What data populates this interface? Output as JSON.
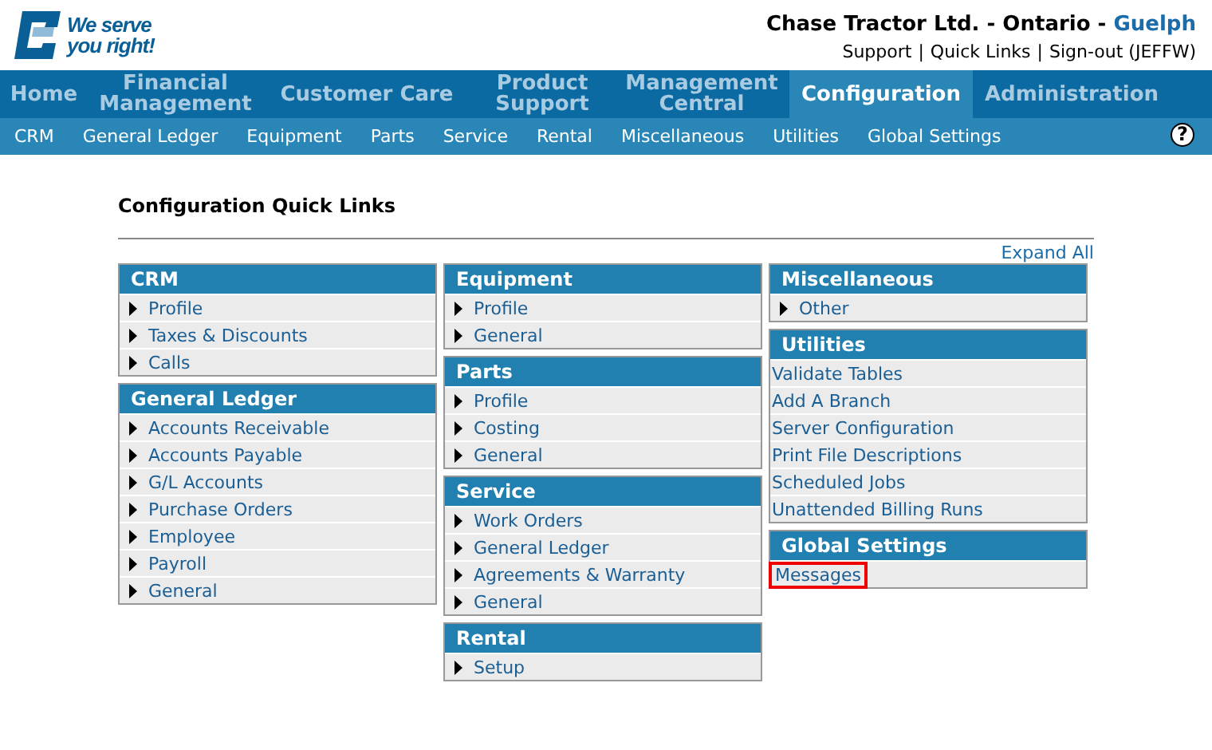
{
  "logo": {
    "slogan_lines": [
      "We serve",
      "you right!"
    ]
  },
  "header": {
    "company": "Chase Tractor Ltd. - Ontario -",
    "branch": "Guelph",
    "links": [
      "Support",
      "Quick Links",
      "Sign-out (JEFFW)"
    ],
    "separator": "|"
  },
  "main_nav": [
    {
      "label": "Home",
      "selected": false
    },
    {
      "label": "Financial Management",
      "selected": false
    },
    {
      "label": "Customer Care",
      "selected": false
    },
    {
      "label": "Product Support",
      "selected": false
    },
    {
      "label": "Management Central",
      "selected": false
    },
    {
      "label": "Configuration",
      "selected": true
    },
    {
      "label": "Administration",
      "selected": false
    }
  ],
  "sub_nav": [
    "CRM",
    "General Ledger",
    "Equipment",
    "Parts",
    "Service",
    "Rental",
    "Miscellaneous",
    "Utilities",
    "Global Settings"
  ],
  "help": {
    "label": "?"
  },
  "page_title": "Configuration Quick Links",
  "expand_all": "Expand All",
  "columns": [
    [
      {
        "title": "CRM",
        "items": [
          {
            "label": "Profile",
            "kind": "arrow",
            "highlighted": false
          },
          {
            "label": "Taxes & Discounts",
            "kind": "arrow",
            "highlighted": false
          },
          {
            "label": "Calls",
            "kind": "arrow",
            "highlighted": false
          }
        ]
      },
      {
        "title": "General Ledger",
        "items": [
          {
            "label": "Accounts Receivable",
            "kind": "arrow",
            "highlighted": false
          },
          {
            "label": "Accounts Payable",
            "kind": "arrow",
            "highlighted": false
          },
          {
            "label": "G/L Accounts",
            "kind": "arrow",
            "highlighted": false
          },
          {
            "label": "Purchase Orders",
            "kind": "arrow",
            "highlighted": false
          },
          {
            "label": "Employee",
            "kind": "arrow",
            "highlighted": false
          },
          {
            "label": "Payroll",
            "kind": "arrow",
            "highlighted": false
          },
          {
            "label": "General",
            "kind": "arrow",
            "highlighted": false
          }
        ]
      }
    ],
    [
      {
        "title": "Equipment",
        "items": [
          {
            "label": "Profile",
            "kind": "arrow",
            "highlighted": false
          },
          {
            "label": "General",
            "kind": "arrow",
            "highlighted": false
          }
        ]
      },
      {
        "title": "Parts",
        "items": [
          {
            "label": "Profile",
            "kind": "arrow",
            "highlighted": false
          },
          {
            "label": "Costing",
            "kind": "arrow",
            "highlighted": false
          },
          {
            "label": "General",
            "kind": "arrow",
            "highlighted": false
          }
        ]
      },
      {
        "title": "Service",
        "items": [
          {
            "label": "Work Orders",
            "kind": "arrow",
            "highlighted": false
          },
          {
            "label": "General Ledger",
            "kind": "arrow",
            "highlighted": false
          },
          {
            "label": "Agreements & Warranty",
            "kind": "arrow",
            "highlighted": false
          },
          {
            "label": "General",
            "kind": "arrow",
            "highlighted": false
          }
        ]
      },
      {
        "title": "Rental",
        "items": [
          {
            "label": "Setup",
            "kind": "arrow",
            "highlighted": false
          }
        ]
      }
    ],
    [
      {
        "title": "Miscellaneous",
        "items": [
          {
            "label": "Other",
            "kind": "arrow",
            "highlighted": false
          }
        ]
      },
      {
        "title": "Utilities",
        "items": [
          {
            "label": "Validate Tables",
            "kind": "plain",
            "highlighted": false
          },
          {
            "label": "Add A Branch",
            "kind": "plain",
            "highlighted": false
          },
          {
            "label": "Server Configuration",
            "kind": "plain",
            "highlighted": false
          },
          {
            "label": "Print File Descriptions",
            "kind": "plain",
            "highlighted": false
          },
          {
            "label": "Scheduled Jobs",
            "kind": "plain",
            "highlighted": false
          },
          {
            "label": "Unattended Billing Runs",
            "kind": "plain",
            "highlighted": false
          }
        ]
      },
      {
        "title": "Global Settings",
        "items": [
          {
            "label": "Messages",
            "kind": "plain",
            "highlighted": true
          }
        ]
      }
    ]
  ]
}
